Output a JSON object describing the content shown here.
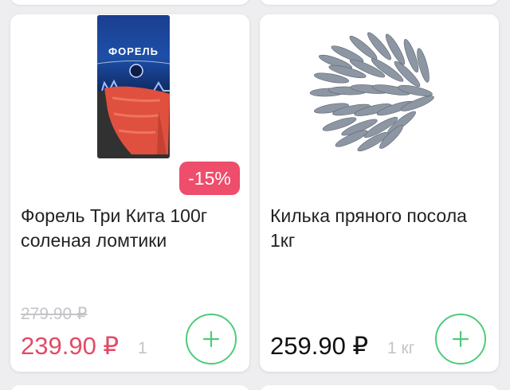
{
  "products": [
    {
      "title": "Форель Три Кита 100г соленая ломтики",
      "package_label": "ФОРЕЛЬ",
      "discount": "-15%",
      "old_price": "279.90 ₽",
      "price": "239.90 ₽",
      "unit": "1",
      "image_icon": "smoked-trout-package-icon",
      "add_icon": "plus-icon"
    },
    {
      "title": "Килька пряного посола 1кг",
      "price": "259.90 ₽",
      "unit": "1 кг",
      "image_icon": "sprats-fish-icon",
      "add_icon": "plus-icon"
    }
  ],
  "colors": {
    "accent_green": "#4ecb7a",
    "sale_red": "#e24b65",
    "discount_badge": "#ee4d6b",
    "muted": "#c4c4c8"
  }
}
